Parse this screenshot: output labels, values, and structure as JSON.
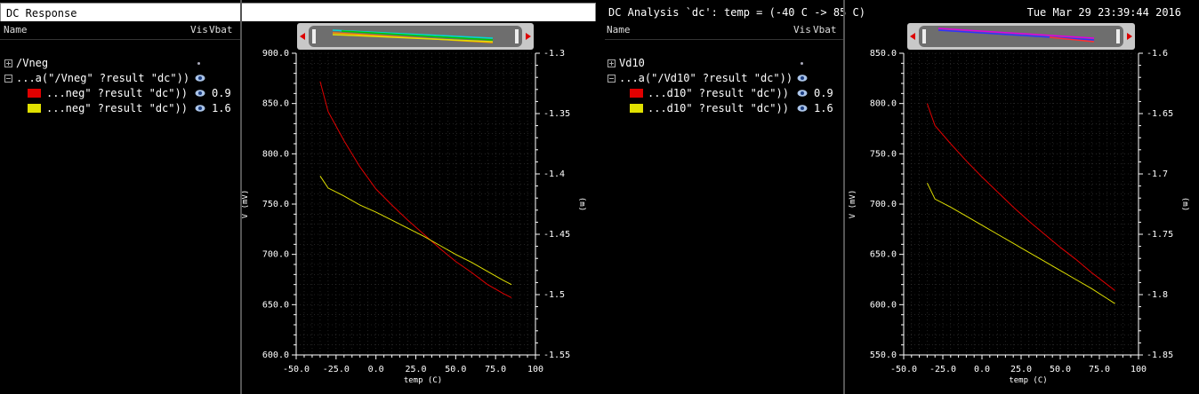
{
  "left_window": {
    "title": "DC Response",
    "columns": {
      "name": "Name",
      "vis": "Vis",
      "vbat": "Vbat"
    },
    "tree": [
      {
        "label": "/Vneg",
        "level": 0,
        "expander": "plus",
        "marker": "dot"
      },
      {
        "label": "...a(\"/Vneg\" ?result \"dc\"))",
        "level": 1,
        "expander": "minus",
        "marker": "eye"
      },
      {
        "label": "...neg\" ?result \"dc\"))",
        "level": 2,
        "swatch": "#e00000",
        "marker": "eye",
        "value": "0.9"
      },
      {
        "label": "...neg\" ?result \"dc\"))",
        "level": 2,
        "swatch": "#e0e000",
        "marker": "eye",
        "value": "1.6"
      }
    ]
  },
  "right_window": {
    "title": "DC Analysis `dc': temp = (-40 C -> 85 C)",
    "timestamp": "Tue Mar 29 23:39:44 2016",
    "columns": {
      "name": "Name",
      "vis": "Vis",
      "vbat": "Vbat"
    },
    "tree": [
      {
        "label": "Vd10",
        "level": 0,
        "expander": "plus",
        "marker": "dot"
      },
      {
        "label": "...a(\"/Vd10\" ?result \"dc\"))",
        "level": 1,
        "expander": "minus",
        "marker": "eye"
      },
      {
        "label": "...d10\" ?result \"dc\"))",
        "level": 2,
        "swatch": "#e00000",
        "marker": "eye",
        "value": "0.9"
      },
      {
        "label": "...d10\" ?result \"dc\"))",
        "level": 2,
        "swatch": "#e0e000",
        "marker": "eye",
        "value": "1.6"
      }
    ]
  },
  "colors": {
    "trace_red": "#e00000",
    "trace_yellow": "#e0e000",
    "grid": "#3a3a3a",
    "axis": "#ffffff"
  },
  "chart_data": [
    {
      "type": "line",
      "xlabel": "temp (C)",
      "ylabel": "V (mV)",
      "y2label": "(m)",
      "xlim": [
        -50,
        100
      ],
      "ylim": [
        600,
        900
      ],
      "y2lim": [
        -1.55,
        -1.3
      ],
      "xticks": [
        "-50.0",
        "-25.0",
        "0.0",
        "25.0",
        "50.0",
        "75.0",
        "100"
      ],
      "yticks": [
        "600.0",
        "650.0",
        "700.0",
        "750.0",
        "800.0",
        "850.0",
        "900.0"
      ],
      "y2ticks": [
        "-1.55",
        "-1.5",
        "-1.45",
        "-1.4",
        "-1.35",
        "-1.3"
      ],
      "grid": true,
      "series": [
        {
          "name": "0.9",
          "color": "#e00000",
          "x": [
            -35,
            -30,
            -20,
            -10,
            0,
            10,
            20,
            30,
            40,
            50,
            60,
            70,
            80,
            85
          ],
          "y": [
            872,
            842,
            813,
            787,
            765,
            749,
            734,
            720,
            706,
            693,
            682,
            670,
            661,
            657
          ]
        },
        {
          "name": "1.6",
          "color": "#e0e000",
          "x": [
            -35,
            -30,
            -20,
            -10,
            0,
            10,
            20,
            30,
            40,
            50,
            60,
            70,
            80,
            85
          ],
          "y": [
            778,
            766,
            758,
            749,
            742,
            734,
            726,
            718,
            709,
            700,
            692,
            683,
            674,
            670
          ]
        }
      ]
    },
    {
      "type": "line",
      "xlabel": "temp (C)",
      "ylabel": "V (mV)",
      "y2label": "(m)",
      "xlim": [
        -50,
        100
      ],
      "ylim": [
        550,
        850
      ],
      "y2lim": [
        -1.85,
        -1.6
      ],
      "xticks": [
        "-50.0",
        "-25.0",
        "0.0",
        "25.0",
        "50.0",
        "75.0",
        "100"
      ],
      "yticks": [
        "550.0",
        "600.0",
        "650.0",
        "700.0",
        "750.0",
        "800.0",
        "850.0"
      ],
      "y2ticks": [
        "-1.85",
        "-1.8",
        "-1.75",
        "-1.7",
        "-1.65",
        "-1.6"
      ],
      "grid": true,
      "series": [
        {
          "name": "0.9",
          "color": "#e00000",
          "x": [
            -35,
            -30,
            -20,
            -10,
            0,
            10,
            20,
            30,
            40,
            50,
            60,
            70,
            80,
            85
          ],
          "y": [
            800,
            778,
            760,
            743,
            727,
            712,
            697,
            683,
            670,
            657,
            645,
            632,
            620,
            614
          ]
        },
        {
          "name": "1.6",
          "color": "#e0e000",
          "x": [
            -35,
            -30,
            -20,
            -10,
            0,
            10,
            20,
            30,
            40,
            50,
            60,
            70,
            80,
            85
          ],
          "y": [
            721,
            705,
            697,
            688,
            679,
            670,
            661,
            652,
            643,
            634,
            625,
            616,
            606,
            601
          ]
        }
      ]
    }
  ]
}
